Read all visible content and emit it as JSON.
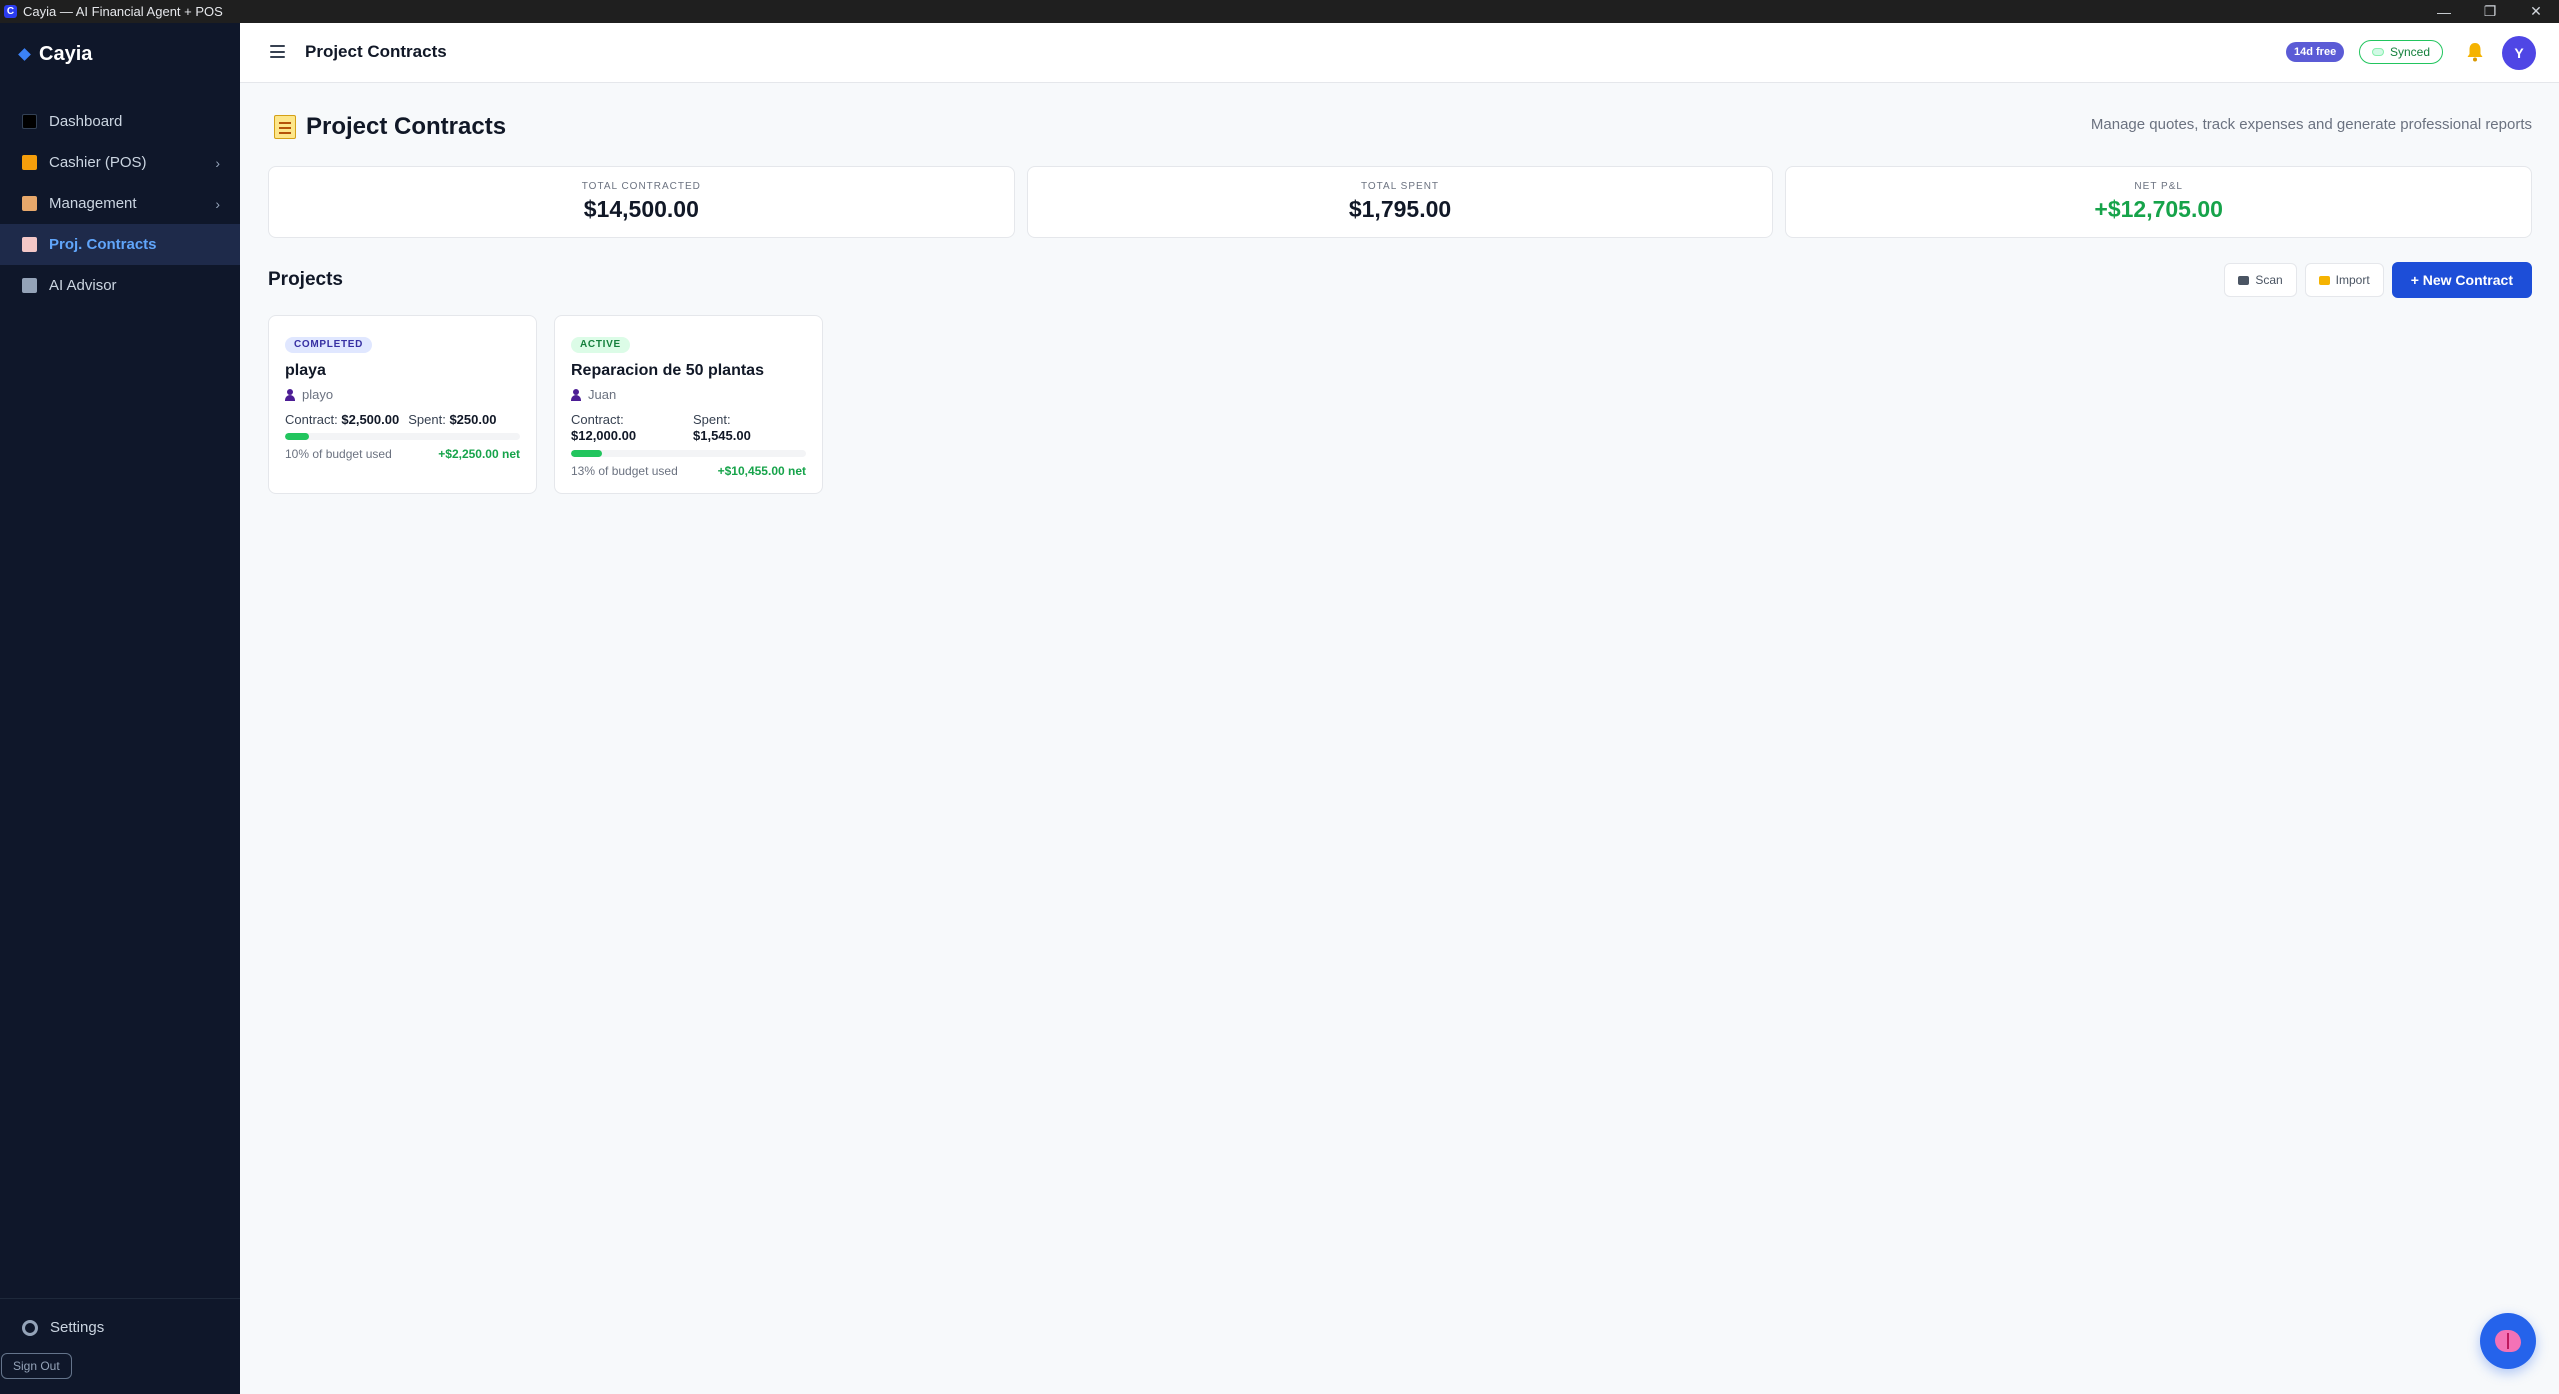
{
  "window": {
    "title": "Cayia — AI Financial Agent + POS",
    "icon_letter": "C",
    "controls": [
      "—",
      "❐",
      "✕"
    ]
  },
  "sidebar": {
    "brand": "Cayia",
    "items": [
      {
        "label": "Dashboard",
        "icon": "dashboard-icon"
      },
      {
        "label": "Cashier (POS)",
        "icon": "money-bag-icon"
      },
      {
        "label": "Management",
        "icon": "clipboard-icon"
      },
      {
        "label": "Proj. Contracts",
        "icon": "contract-icon"
      },
      {
        "label": "AI Advisor",
        "icon": "robot-icon"
      }
    ],
    "settings_label": "Settings",
    "signout_label": "Sign Out"
  },
  "header": {
    "title": "Project Contracts",
    "trial_badge": "14d free",
    "sync_label": "Synced",
    "avatar_initial": "Y"
  },
  "page": {
    "title": "Project Contracts",
    "subtitle": "Manage quotes, track expenses and generate professional reports"
  },
  "stats": [
    {
      "label": "TOTAL CONTRACTED",
      "value": "$14,500.00"
    },
    {
      "label": "TOTAL SPENT",
      "value": "$1,795.00"
    },
    {
      "label": "NET P&L",
      "value": "+$12,705.00"
    }
  ],
  "projects": {
    "heading": "Projects",
    "scan_label": "Scan",
    "import_label": "Import",
    "new_label": "+ New Contract",
    "cards": [
      {
        "status": "COMPLETED",
        "name": "playa",
        "client": "playo",
        "contract_label": "Contract:",
        "contract_value": "$2,500.00",
        "spent_label": "Spent:",
        "spent_value": "$250.00",
        "budget_used_fraction": 0.1,
        "budget_text": "10% of budget used",
        "net": "+$2,250.00 net"
      },
      {
        "status": "ACTIVE",
        "name": "Reparacion de 50 plantas",
        "client": "Juan",
        "contract_label": "Contract:",
        "contract_value": "$12,000.00",
        "spent_label": "Spent:",
        "spent_value": "$1,545.00",
        "budget_used_fraction": 0.13,
        "budget_text": "13% of budget used",
        "net": "+$10,455.00 net"
      }
    ]
  },
  "colors": {
    "accent": "#1d4ed8",
    "positive": "#16a34a",
    "sidebar_bg": "#0f172a"
  }
}
